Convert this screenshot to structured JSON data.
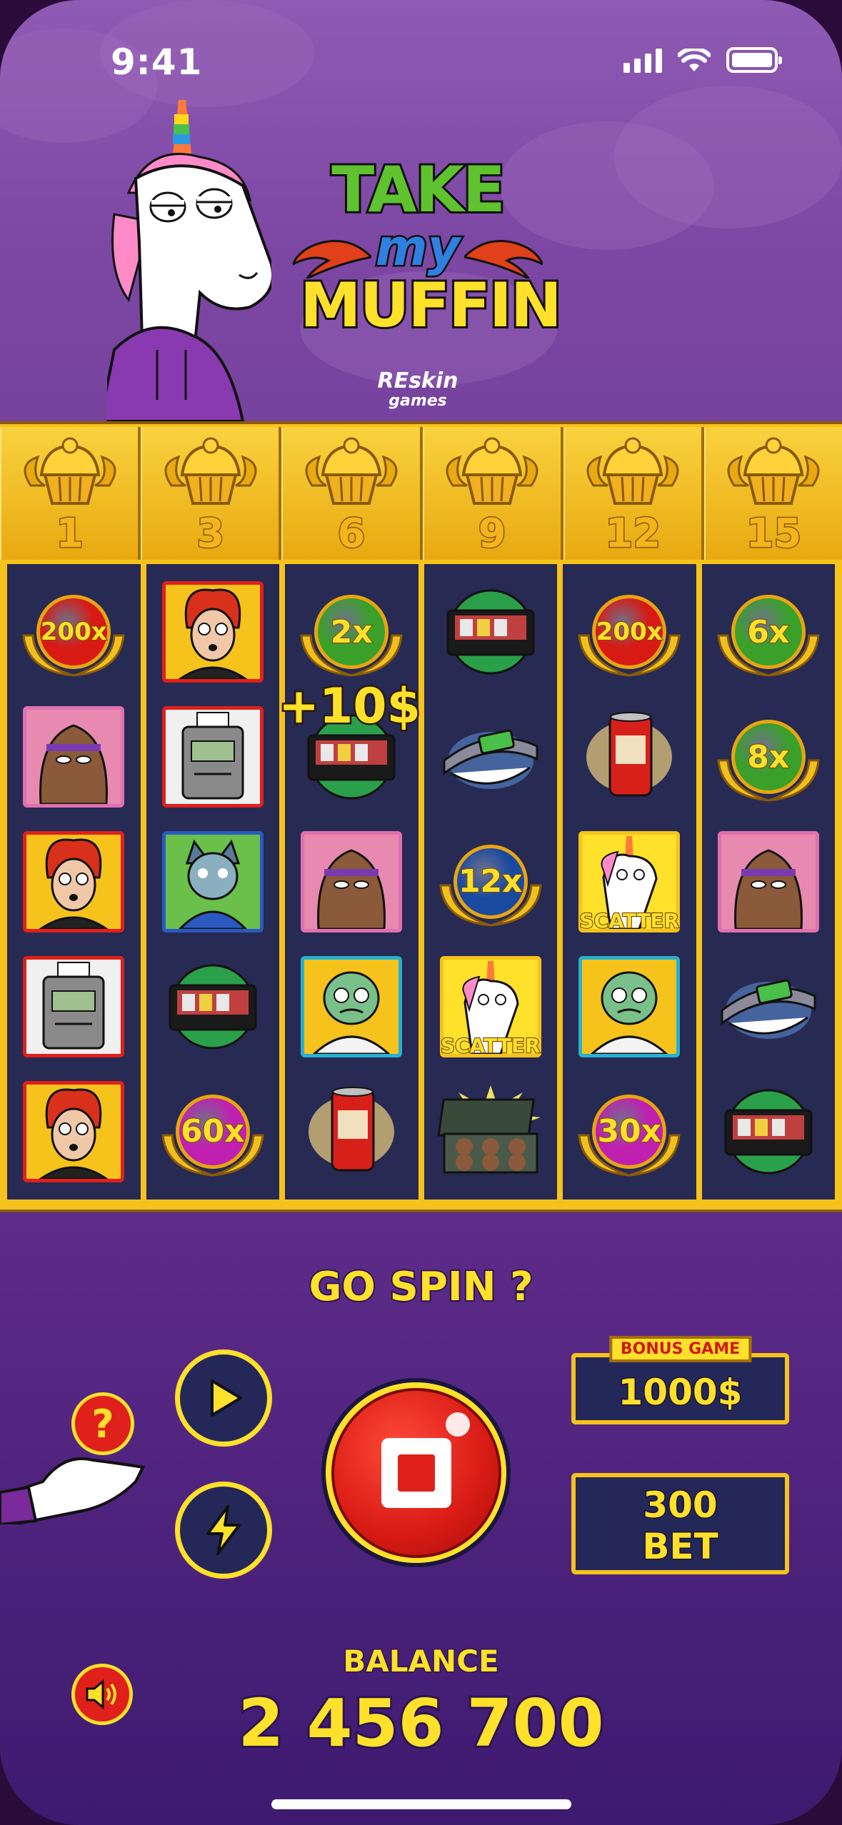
{
  "status_bar": {
    "time": "9:41"
  },
  "logo": {
    "line1": "TAKE",
    "line2": "my",
    "line3": "MUFFIN"
  },
  "studio": {
    "name": "REskin",
    "sub": "games"
  },
  "multipliers": [
    "1",
    "3",
    "6",
    "9",
    "12",
    "15"
  ],
  "reels": [
    [
      {
        "kind": "orb",
        "label": "200x",
        "color": "#d81a14"
      },
      {
        "kind": "portrait",
        "name": "brown-blob",
        "border": "#e070b0",
        "bg": "#e88ab0"
      },
      {
        "kind": "portrait",
        "name": "redhead-woman",
        "border": "#e0201a",
        "bg": "#f6c21c"
      },
      {
        "kind": "portrait",
        "name": "paper-robot",
        "border": "#e0201a",
        "bg": "#f0f0f0"
      },
      {
        "kind": "portrait",
        "name": "redhead-woman",
        "border": "#e0201a",
        "bg": "#f6c21c"
      }
    ],
    [
      {
        "kind": "portrait",
        "name": "redhead-woman",
        "border": "#e0201a",
        "bg": "#f6c21c"
      },
      {
        "kind": "portrait",
        "name": "paper-robot",
        "border": "#e0201a",
        "bg": "#f0f0f0"
      },
      {
        "kind": "portrait",
        "name": "blue-cat-man",
        "border": "#2a5ac0",
        "bg": "#6ac04a"
      },
      {
        "kind": "item",
        "name": "vhs-tape"
      },
      {
        "kind": "orb",
        "label": "60x",
        "color": "#c020b0"
      }
    ],
    [
      {
        "kind": "orb",
        "label": "2x",
        "color": "#3aa02a"
      },
      {
        "kind": "item",
        "name": "vhs-tape"
      },
      {
        "kind": "portrait",
        "name": "brown-blob",
        "border": "#e070b0",
        "bg": "#e88ab0"
      },
      {
        "kind": "portrait",
        "name": "green-scientist",
        "border": "#28b0d0",
        "bg": "#f6c21c"
      },
      {
        "kind": "item",
        "name": "soda-can"
      }
    ],
    [
      {
        "kind": "item",
        "name": "vhs-tape"
      },
      {
        "kind": "item",
        "name": "belt"
      },
      {
        "kind": "orb",
        "label": "12x",
        "color": "#1a4aa0"
      },
      {
        "kind": "scatter",
        "label": "SCATTER"
      },
      {
        "kind": "item",
        "name": "muffin-box"
      }
    ],
    [
      {
        "kind": "orb",
        "label": "200x",
        "color": "#d81a14"
      },
      {
        "kind": "item",
        "name": "soda-can"
      },
      {
        "kind": "scatter",
        "label": "SCATTER"
      },
      {
        "kind": "portrait",
        "name": "green-scientist",
        "border": "#28b0d0",
        "bg": "#f6c21c"
      },
      {
        "kind": "orb",
        "label": "30x",
        "color": "#c020b0"
      }
    ],
    [
      {
        "kind": "orb",
        "label": "6x",
        "color": "#3aa02a"
      },
      {
        "kind": "orb",
        "label": "8x",
        "color": "#3aa02a"
      },
      {
        "kind": "portrait",
        "name": "brown-blob",
        "border": "#e070b0",
        "bg": "#e88ab0"
      },
      {
        "kind": "item",
        "name": "belt"
      },
      {
        "kind": "item",
        "name": "vhs-tape"
      }
    ]
  ],
  "win_popup": "+10$",
  "prompt": "GO SPIN ?",
  "bonus": {
    "tag": "BONUS GAME",
    "amount": "1000$"
  },
  "bet": {
    "line1": "300",
    "line2": "BET"
  },
  "balance": {
    "label": "BALANCE",
    "value": "2 456 700"
  },
  "colors": {
    "accent": "#ffe02a",
    "panel": "#232858",
    "spin": "#e0201a",
    "gold": "#f6c21c"
  }
}
